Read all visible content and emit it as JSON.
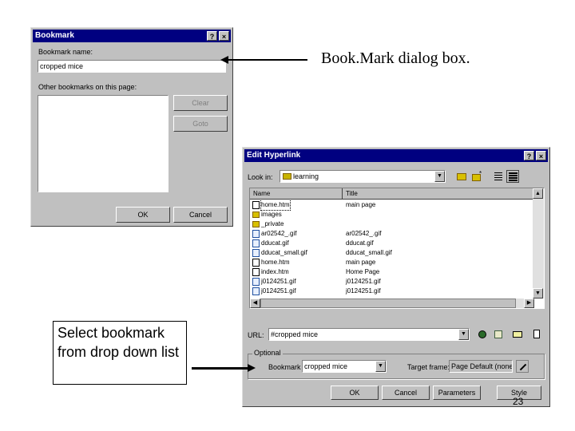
{
  "bookmark_dialog": {
    "title": "Bookmark",
    "name_label": "Bookmark name:",
    "name_value": "cropped mice",
    "other_label": "Other bookmarks on this page:",
    "clear_label": "Clear",
    "goto_label": "Goto",
    "ok_label": "OK",
    "cancel_label": "Cancel"
  },
  "callout_top": "Book.Mark dialog box.",
  "callout_bottom": "Select bookmark from drop down list",
  "edit_hyperlink": {
    "title": "Edit Hyperlink",
    "lookin_label": "Look in:",
    "lookin_value": "learning",
    "columns": {
      "name": "Name",
      "title": "Title"
    },
    "files": [
      {
        "name": "home.htm",
        "title": "main page",
        "icon": "page-icon"
      },
      {
        "name": "images",
        "title": "",
        "icon": "folder-icon"
      },
      {
        "name": "_private",
        "title": "",
        "icon": "folder-icon"
      },
      {
        "name": "ar02542_.gif",
        "title": "ar02542_.gif",
        "icon": "image-icon"
      },
      {
        "name": "dducat.gif",
        "title": "dducat.gif",
        "icon": "image-icon"
      },
      {
        "name": "dducat_small.gif",
        "title": "dducat_small.gif",
        "icon": "image-icon"
      },
      {
        "name": "home.htm",
        "title": "main page",
        "icon": "page-icon"
      },
      {
        "name": "index.htm",
        "title": "Home Page",
        "icon": "page-icon"
      },
      {
        "name": "j0124251.gif",
        "title": "j0124251.gif",
        "icon": "image-icon"
      },
      {
        "name": "j0124251.gif",
        "title": "j0124251.gif",
        "icon": "image-icon"
      }
    ],
    "url_label": "URL:",
    "url_value": "#cropped mice",
    "optional_label": "Optional",
    "bookmark_label": "Bookmark",
    "bookmark_value": "cropped mice",
    "target_label": "Target frame:",
    "target_value": "Page Default (none)",
    "ok_label": "OK",
    "cancel_label": "Cancel",
    "parameters_label": "Parameters",
    "style_label": "Style"
  },
  "slide_number": "23",
  "colors": {
    "titlebar": "#000080",
    "face": "#c0c0c0"
  }
}
